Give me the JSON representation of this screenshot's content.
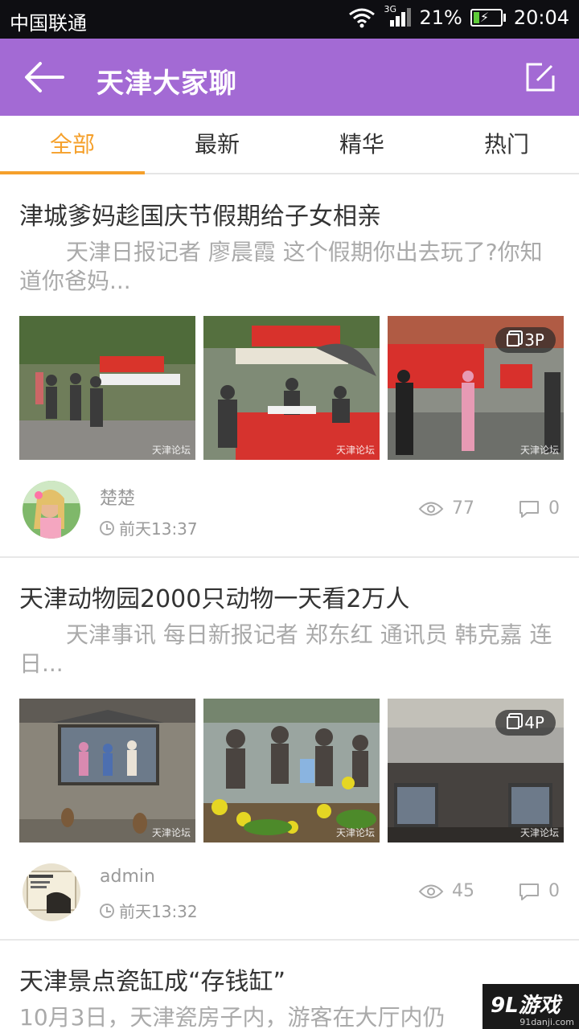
{
  "status_bar": {
    "carrier": "中国联通",
    "network": "3G",
    "battery": "21%",
    "battery_level": 0.21,
    "time": "20:04"
  },
  "app_bar": {
    "title": "天津大家聊",
    "back_icon": "arrow-left-icon",
    "compose_icon": "compose-icon"
  },
  "tabs": [
    {
      "label": "全部",
      "active": true
    },
    {
      "label": "最新",
      "active": false
    },
    {
      "label": "精华",
      "active": false
    },
    {
      "label": "热门",
      "active": false
    }
  ],
  "posts": [
    {
      "title": "津城爹妈趁国庆节假期给子女相亲",
      "summary": "天津日报记者 廖晨霞  这个假期你出去玩了?你知道你爸妈...",
      "photo_count": "3P",
      "watermark": "天津论坛",
      "author": "楚楚",
      "time": "前天13:37",
      "views": "77",
      "comments": "0"
    },
    {
      "title": "天津动物园2000只动物一天看2万人",
      "summary": "天津事讯  每日新报记者 郑东红 通讯员 韩克嘉 连日...",
      "photo_count": "4P",
      "watermark": "天津论坛",
      "author": "admin",
      "time": "前天13:32",
      "views": "45",
      "comments": "0"
    },
    {
      "title": "天津景点瓷缸成“存钱缸”",
      "summary": "10月3日，天津瓷房子内，游客在大厅内仍"
    }
  ],
  "corner_watermark": {
    "brand": "9L游戏",
    "site": "91danji.com"
  },
  "colors": {
    "app_bar": "#a36ad4",
    "tab_active": "#f5a02b",
    "status_bar": "#0e0e12"
  }
}
